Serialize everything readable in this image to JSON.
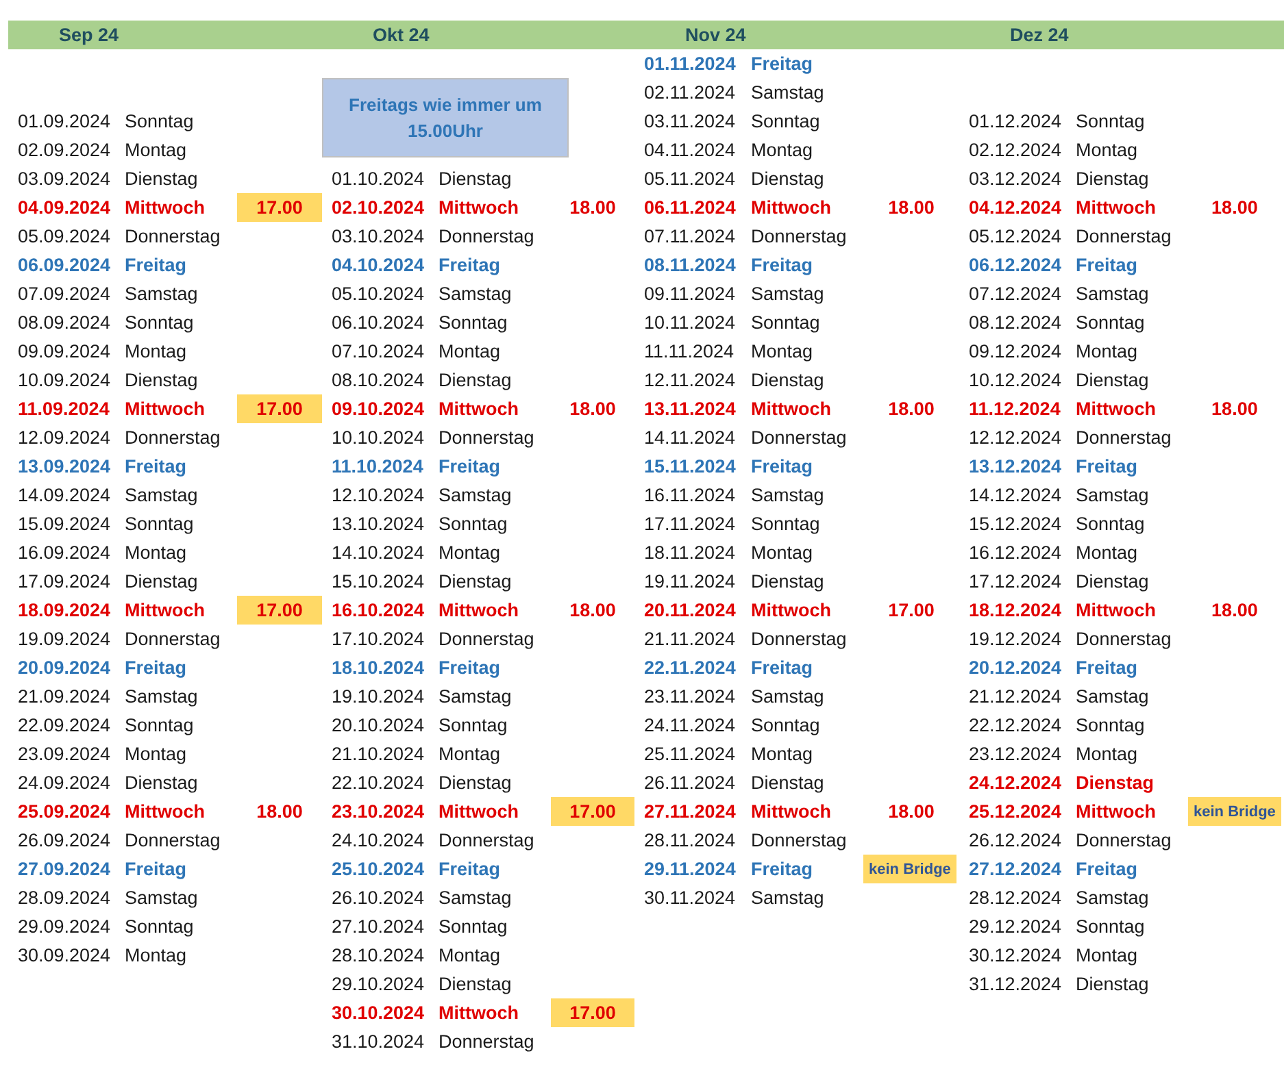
{
  "months": [
    {
      "label": "Sep 24",
      "days": [
        {
          "date": "01.09.2024",
          "day": "Sonntag",
          "kind": "plain"
        },
        {
          "date": "02.09.2024",
          "day": "Montag",
          "kind": "plain"
        },
        {
          "date": "03.09.2024",
          "day": "Dienstag",
          "kind": "plain"
        },
        {
          "date": "04.09.2024",
          "day": "Mittwoch",
          "kind": "meeting",
          "slot": {
            "kind": "time",
            "text": "17.00",
            "highlighted": true
          }
        },
        {
          "date": "05.09.2024",
          "day": "Donnerstag",
          "kind": "plain"
        },
        {
          "date": "06.09.2024",
          "day": "Freitag",
          "kind": "friday"
        },
        {
          "date": "07.09.2024",
          "day": "Samstag",
          "kind": "plain"
        },
        {
          "date": "08.09.2024",
          "day": "Sonntag",
          "kind": "plain"
        },
        {
          "date": "09.09.2024",
          "day": "Montag",
          "kind": "plain"
        },
        {
          "date": "10.09.2024",
          "day": "Dienstag",
          "kind": "plain"
        },
        {
          "date": "11.09.2024",
          "day": "Mittwoch",
          "kind": "meeting",
          "slot": {
            "kind": "time",
            "text": "17.00",
            "highlighted": true
          }
        },
        {
          "date": "12.09.2024",
          "day": "Donnerstag",
          "kind": "plain"
        },
        {
          "date": "13.09.2024",
          "day": "Freitag",
          "kind": "friday"
        },
        {
          "date": "14.09.2024",
          "day": "Samstag",
          "kind": "plain"
        },
        {
          "date": "15.09.2024",
          "day": "Sonntag",
          "kind": "plain"
        },
        {
          "date": "16.09.2024",
          "day": "Montag",
          "kind": "plain"
        },
        {
          "date": "17.09.2024",
          "day": "Dienstag",
          "kind": "plain"
        },
        {
          "date": "18.09.2024",
          "day": "Mittwoch",
          "kind": "meeting",
          "slot": {
            "kind": "time",
            "text": "17.00",
            "highlighted": true
          }
        },
        {
          "date": "19.09.2024",
          "day": "Donnerstag",
          "kind": "plain"
        },
        {
          "date": "20.09.2024",
          "day": "Freitag",
          "kind": "friday"
        },
        {
          "date": "21.09.2024",
          "day": "Samstag",
          "kind": "plain"
        },
        {
          "date": "22.09.2024",
          "day": "Sonntag",
          "kind": "plain"
        },
        {
          "date": "23.09.2024",
          "day": "Montag",
          "kind": "plain"
        },
        {
          "date": "24.09.2024",
          "day": "Dienstag",
          "kind": "plain"
        },
        {
          "date": "25.09.2024",
          "day": "Mittwoch",
          "kind": "meeting",
          "slot": {
            "kind": "time",
            "text": "18.00",
            "highlighted": false
          }
        },
        {
          "date": "26.09.2024",
          "day": "Donnerstag",
          "kind": "plain"
        },
        {
          "date": "27.09.2024",
          "day": "Freitag",
          "kind": "friday"
        },
        {
          "date": "28.09.2024",
          "day": "Samstag",
          "kind": "plain"
        },
        {
          "date": "29.09.2024",
          "day": "Sonntag",
          "kind": "plain"
        },
        {
          "date": "30.09.2024",
          "day": "Montag",
          "kind": "plain"
        }
      ]
    },
    {
      "label": "Okt 24",
      "note": "Freitags wie immer um 15.00Uhr",
      "days": [
        {
          "date": "01.10.2024",
          "day": "Dienstag",
          "kind": "plain"
        },
        {
          "date": "02.10.2024",
          "day": "Mittwoch",
          "kind": "meeting",
          "slot": {
            "kind": "time",
            "text": "18.00",
            "highlighted": false
          }
        },
        {
          "date": "03.10.2024",
          "day": "Donnerstag",
          "kind": "plain"
        },
        {
          "date": "04.10.2024",
          "day": "Freitag",
          "kind": "friday"
        },
        {
          "date": "05.10.2024",
          "day": "Samstag",
          "kind": "plain"
        },
        {
          "date": "06.10.2024",
          "day": "Sonntag",
          "kind": "plain"
        },
        {
          "date": "07.10.2024",
          "day": "Montag",
          "kind": "plain"
        },
        {
          "date": "08.10.2024",
          "day": "Dienstag",
          "kind": "plain"
        },
        {
          "date": "09.10.2024",
          "day": "Mittwoch",
          "kind": "meeting",
          "slot": {
            "kind": "time",
            "text": "18.00",
            "highlighted": false
          }
        },
        {
          "date": "10.10.2024",
          "day": "Donnerstag",
          "kind": "plain"
        },
        {
          "date": "11.10.2024",
          "day": "Freitag",
          "kind": "friday"
        },
        {
          "date": "12.10.2024",
          "day": "Samstag",
          "kind": "plain"
        },
        {
          "date": "13.10.2024",
          "day": "Sonntag",
          "kind": "plain"
        },
        {
          "date": "14.10.2024",
          "day": "Montag",
          "kind": "plain"
        },
        {
          "date": "15.10.2024",
          "day": "Dienstag",
          "kind": "plain"
        },
        {
          "date": "16.10.2024",
          "day": "Mittwoch",
          "kind": "meeting",
          "slot": {
            "kind": "time",
            "text": "18.00",
            "highlighted": false
          }
        },
        {
          "date": "17.10.2024",
          "day": "Donnerstag",
          "kind": "plain"
        },
        {
          "date": "18.10.2024",
          "day": "Freitag",
          "kind": "friday"
        },
        {
          "date": "19.10.2024",
          "day": "Samstag",
          "kind": "plain"
        },
        {
          "date": "20.10.2024",
          "day": "Sonntag",
          "kind": "plain"
        },
        {
          "date": "21.10.2024",
          "day": "Montag",
          "kind": "plain"
        },
        {
          "date": "22.10.2024",
          "day": "Dienstag",
          "kind": "plain"
        },
        {
          "date": "23.10.2024",
          "day": "Mittwoch",
          "kind": "meeting",
          "slot": {
            "kind": "time",
            "text": "17.00",
            "highlighted": true
          }
        },
        {
          "date": "24.10.2024",
          "day": "Donnerstag",
          "kind": "plain"
        },
        {
          "date": "25.10.2024",
          "day": "Freitag",
          "kind": "friday"
        },
        {
          "date": "26.10.2024",
          "day": "Samstag",
          "kind": "plain"
        },
        {
          "date": "27.10.2024",
          "day": "Sonntag",
          "kind": "plain"
        },
        {
          "date": "28.10.2024",
          "day": "Montag",
          "kind": "plain"
        },
        {
          "date": "29.10.2024",
          "day": "Dienstag",
          "kind": "plain"
        },
        {
          "date": "30.10.2024",
          "day": "Mittwoch",
          "kind": "meeting",
          "slot": {
            "kind": "time",
            "text": "17.00",
            "highlighted": true
          }
        },
        {
          "date": "31.10.2024",
          "day": "Donnerstag",
          "kind": "plain"
        }
      ]
    },
    {
      "label": "Nov 24",
      "days": [
        {
          "date": "01.11.2024",
          "day": "Freitag",
          "kind": "friday"
        },
        {
          "date": "02.11.2024",
          "day": "Samstag",
          "kind": "plain"
        },
        {
          "date": "03.11.2024",
          "day": "Sonntag",
          "kind": "plain"
        },
        {
          "date": "04.11.2024",
          "day": "Montag",
          "kind": "plain"
        },
        {
          "date": "05.11.2024",
          "day": "Dienstag",
          "kind": "plain"
        },
        {
          "date": "06.11.2024",
          "day": "Mittwoch",
          "kind": "meeting",
          "slot": {
            "kind": "time",
            "text": "18.00",
            "highlighted": false
          }
        },
        {
          "date": "07.11.2024",
          "day": "Donnerstag",
          "kind": "plain"
        },
        {
          "date": "08.11.2024",
          "day": "Freitag",
          "kind": "friday"
        },
        {
          "date": "09.11.2024",
          "day": "Samstag",
          "kind": "plain"
        },
        {
          "date": "10.11.2024",
          "day": "Sonntag",
          "kind": "plain"
        },
        {
          "date": "11.11.2024",
          "day": "Montag",
          "kind": "plain"
        },
        {
          "date": "12.11.2024",
          "day": "Dienstag",
          "kind": "plain"
        },
        {
          "date": "13.11.2024",
          "day": "Mittwoch",
          "kind": "meeting",
          "slot": {
            "kind": "time",
            "text": "18.00",
            "highlighted": false
          }
        },
        {
          "date": "14.11.2024",
          "day": "Donnerstag",
          "kind": "plain"
        },
        {
          "date": "15.11.2024",
          "day": "Freitag",
          "kind": "friday"
        },
        {
          "date": "16.11.2024",
          "day": "Samstag",
          "kind": "plain"
        },
        {
          "date": "17.11.2024",
          "day": "Sonntag",
          "kind": "plain"
        },
        {
          "date": "18.11.2024",
          "day": "Montag",
          "kind": "plain"
        },
        {
          "date": "19.11.2024",
          "day": "Dienstag",
          "kind": "plain"
        },
        {
          "date": "20.11.2024",
          "day": "Mittwoch",
          "kind": "meeting",
          "slot": {
            "kind": "time",
            "text": "17.00",
            "highlighted": false
          }
        },
        {
          "date": "21.11.2024",
          "day": "Donnerstag",
          "kind": "plain"
        },
        {
          "date": "22.11.2024",
          "day": "Freitag",
          "kind": "friday"
        },
        {
          "date": "23.11.2024",
          "day": "Samstag",
          "kind": "plain"
        },
        {
          "date": "24.11.2024",
          "day": "Sonntag",
          "kind": "plain"
        },
        {
          "date": "25.11.2024",
          "day": "Montag",
          "kind": "plain"
        },
        {
          "date": "26.11.2024",
          "day": "Dienstag",
          "kind": "plain"
        },
        {
          "date": "27.11.2024",
          "day": "Mittwoch",
          "kind": "meeting",
          "slot": {
            "kind": "time",
            "text": "18.00",
            "highlighted": false
          }
        },
        {
          "date": "28.11.2024",
          "day": "Donnerstag",
          "kind": "plain"
        },
        {
          "date": "29.11.2024",
          "day": "Freitag",
          "kind": "friday",
          "slot": {
            "kind": "note",
            "text": "kein Bridge",
            "highlighted": true
          }
        },
        {
          "date": "30.11.2024",
          "day": "Samstag",
          "kind": "plain"
        }
      ]
    },
    {
      "label": "Dez 24",
      "days": [
        {
          "date": "01.12.2024",
          "day": "Sonntag",
          "kind": "plain"
        },
        {
          "date": "02.12.2024",
          "day": "Montag",
          "kind": "plain"
        },
        {
          "date": "03.12.2024",
          "day": "Dienstag",
          "kind": "plain"
        },
        {
          "date": "04.12.2024",
          "day": "Mittwoch",
          "kind": "meeting",
          "slot": {
            "kind": "time",
            "text": "18.00",
            "highlighted": false
          }
        },
        {
          "date": "05.12.2024",
          "day": "Donnerstag",
          "kind": "plain"
        },
        {
          "date": "06.12.2024",
          "day": "Freitag",
          "kind": "friday"
        },
        {
          "date": "07.12.2024",
          "day": "Samstag",
          "kind": "plain"
        },
        {
          "date": "08.12.2024",
          "day": "Sonntag",
          "kind": "plain"
        },
        {
          "date": "09.12.2024",
          "day": "Montag",
          "kind": "plain"
        },
        {
          "date": "10.12.2024",
          "day": "Dienstag",
          "kind": "plain"
        },
        {
          "date": "11.12.2024",
          "day": "Mittwoch",
          "kind": "meeting",
          "slot": {
            "kind": "time",
            "text": "18.00",
            "highlighted": false
          }
        },
        {
          "date": "12.12.2024",
          "day": "Donnerstag",
          "kind": "plain"
        },
        {
          "date": "13.12.2024",
          "day": "Freitag",
          "kind": "friday"
        },
        {
          "date": "14.12.2024",
          "day": "Samstag",
          "kind": "plain"
        },
        {
          "date": "15.12.2024",
          "day": "Sonntag",
          "kind": "plain"
        },
        {
          "date": "16.12.2024",
          "day": "Montag",
          "kind": "plain"
        },
        {
          "date": "17.12.2024",
          "day": "Dienstag",
          "kind": "plain"
        },
        {
          "date": "18.12.2024",
          "day": "Mittwoch",
          "kind": "meeting",
          "slot": {
            "kind": "time",
            "text": "18.00",
            "highlighted": false
          }
        },
        {
          "date": "19.12.2024",
          "day": "Donnerstag",
          "kind": "plain"
        },
        {
          "date": "20.12.2024",
          "day": "Freitag",
          "kind": "friday"
        },
        {
          "date": "21.12.2024",
          "day": "Samstag",
          "kind": "plain"
        },
        {
          "date": "22.12.2024",
          "day": "Sonntag",
          "kind": "plain"
        },
        {
          "date": "23.12.2024",
          "day": "Montag",
          "kind": "plain"
        },
        {
          "date": "24.12.2024",
          "day": "Dienstag",
          "kind": "meeting"
        },
        {
          "date": "25.12.2024",
          "day": "Mittwoch",
          "kind": "meeting",
          "slot": {
            "kind": "note",
            "text": "kein Bridge",
            "highlighted": true
          }
        },
        {
          "date": "26.12.2024",
          "day": "Donnerstag",
          "kind": "plain"
        },
        {
          "date": "27.12.2024",
          "day": "Freitag",
          "kind": "friday"
        },
        {
          "date": "28.12.2024",
          "day": "Samstag",
          "kind": "plain"
        },
        {
          "date": "29.12.2024",
          "day": "Sonntag",
          "kind": "plain"
        },
        {
          "date": "30.12.2024",
          "day": "Montag",
          "kind": "plain"
        },
        {
          "date": "31.12.2024",
          "day": "Dienstag",
          "kind": "plain"
        }
      ]
    }
  ]
}
